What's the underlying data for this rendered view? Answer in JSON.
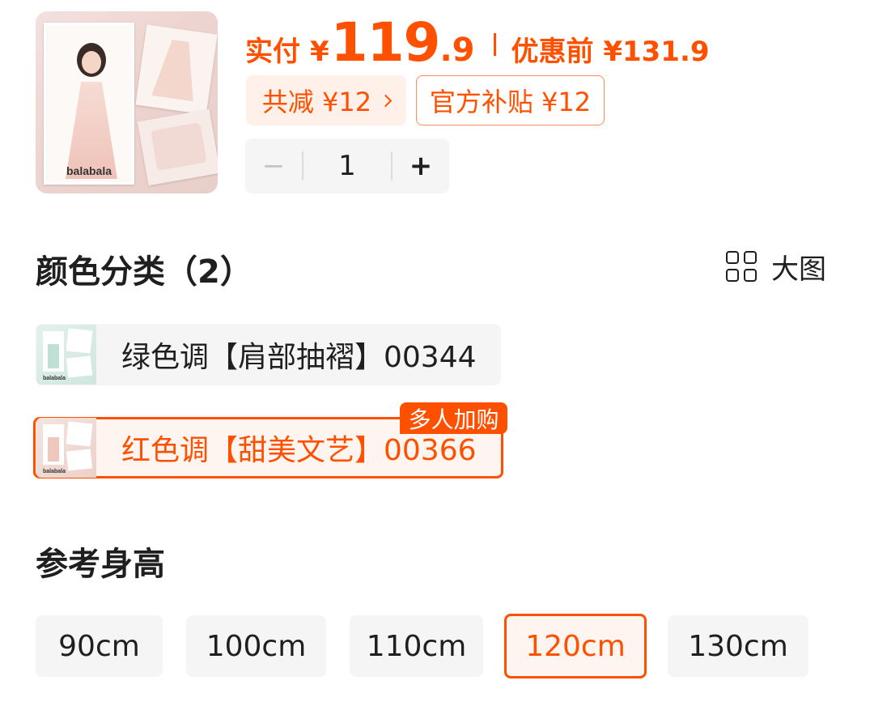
{
  "product": {
    "thumbnail_brand": "balabala"
  },
  "price": {
    "label": "实付",
    "currency": "¥",
    "integer": "119",
    "decimal": ".9",
    "before_label": "优惠前 ¥131.9"
  },
  "tags": {
    "total_discount": "共减 ¥12",
    "subsidy": "官方补贴 ¥12"
  },
  "quantity": {
    "minus": "−",
    "value": "1",
    "plus": "+"
  },
  "color_section": {
    "title": "颜色分类（2）",
    "big_image_label": "大图",
    "options": [
      {
        "label": "绿色调【肩部抽褶】00344",
        "selected": false,
        "thumb_brand": "balabala"
      },
      {
        "label": "红色调【甜美文艺】00366",
        "selected": true,
        "badge": "多人加购",
        "thumb_brand": "balabala"
      }
    ]
  },
  "size_section": {
    "title": "参考身高",
    "options": [
      {
        "label": "90cm",
        "selected": false
      },
      {
        "label": "100cm",
        "selected": false
      },
      {
        "label": "110cm",
        "selected": false
      },
      {
        "label": "120cm",
        "selected": true
      },
      {
        "label": "130cm",
        "selected": false
      }
    ]
  },
  "colors": {
    "accent": "#ff5000",
    "accent_bg": "#fff0ea",
    "chip_bg": "#f5f5f5",
    "text": "#1f1f1f"
  }
}
